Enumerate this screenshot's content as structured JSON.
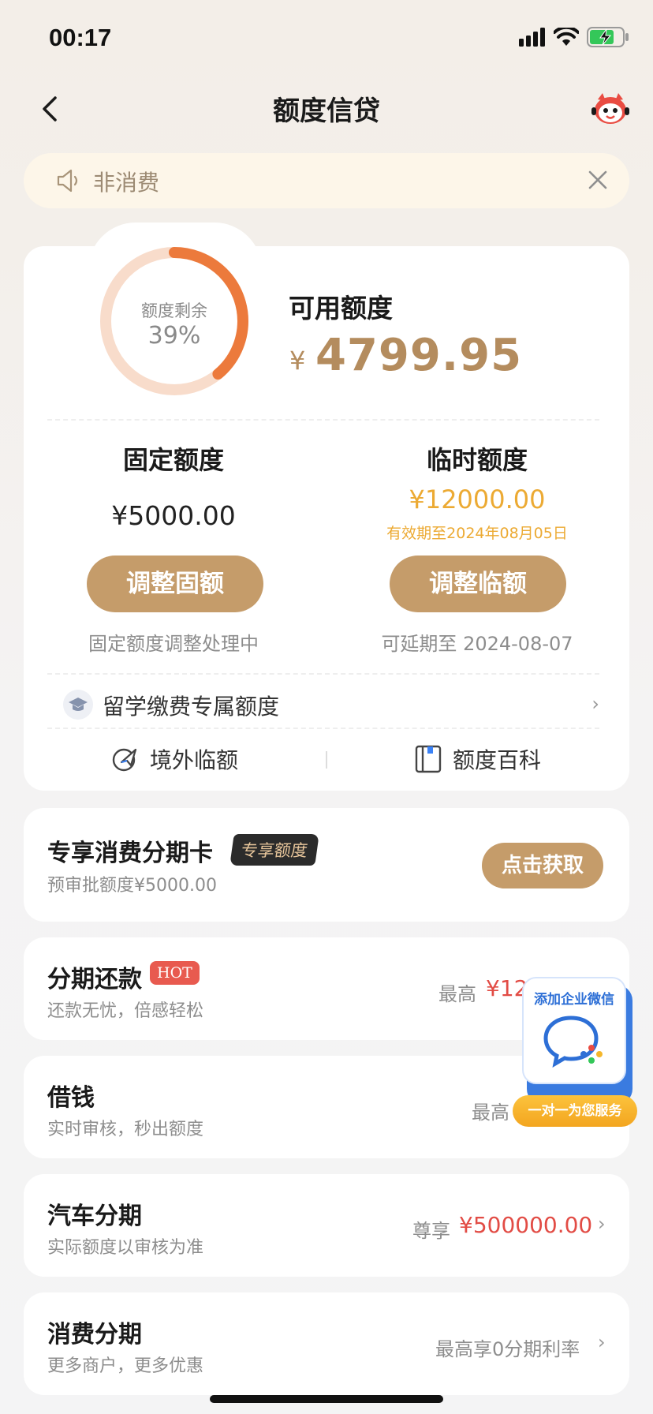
{
  "status": {
    "time": "00:17"
  },
  "nav": {
    "title": "额度信贷"
  },
  "notice": {
    "text": "非消费"
  },
  "credit": {
    "ring_label": "额度剩余",
    "ring_percent": "39%",
    "ring_fraction": 0.39,
    "available_label": "可用额度",
    "currency": "¥",
    "available_amount": "4799.95",
    "fixed": {
      "title": "固定额度",
      "amount": "¥5000.00",
      "button": "调整固额",
      "note": "固定额度调整处理中"
    },
    "temporary": {
      "title": "临时额度",
      "amount": "¥12000.00",
      "valid": "有效期至2024年08月05日",
      "button": "调整临额",
      "note": "可延期至 2024-08-07"
    },
    "study_abroad": "留学缴费专属额度",
    "links": {
      "overseas": "境外临额",
      "encyclopedia": "额度百科"
    }
  },
  "cards": {
    "installment_card": {
      "title": "专享消费分期卡",
      "badge": "专享额度",
      "sub": "预审批额度¥5000.00",
      "button": "点击获取"
    },
    "installment_repay": {
      "title": "分期还款",
      "badge": "HOT",
      "sub": "还款无忧，倍感轻松",
      "right_label": "最高",
      "right_value": "¥12"
    },
    "borrow": {
      "title": "借钱",
      "sub": "实时审核，秒出额度",
      "right_label": "最高"
    },
    "car": {
      "title": "汽车分期",
      "sub": "实际额度以审核为准",
      "right_label": "尊享",
      "right_value": "¥500000.00"
    },
    "consumer": {
      "title": "消费分期",
      "sub": "更多商户，更多优惠",
      "right_label": "最高享0分期利率"
    }
  },
  "floating": {
    "title": "添加企业微信",
    "tag": "一对一为您服务"
  }
}
